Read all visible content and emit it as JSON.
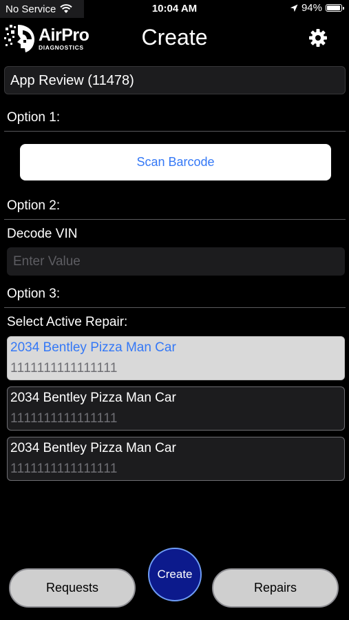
{
  "status_bar": {
    "carrier": "No Service",
    "time": "10:04 AM",
    "battery_percent": "94%",
    "battery_level": 0.94
  },
  "header": {
    "logo": {
      "name": "AirPro",
      "subtitle": "DIAGNOSTICS"
    },
    "title": "Create",
    "settings_icon": "gear-icon"
  },
  "shop_selector": {
    "value": "App Review (11478)"
  },
  "option1": {
    "label": "Option 1:",
    "scan_button_label": "Scan Barcode"
  },
  "option2": {
    "label": "Option 2:",
    "decode_label": "Decode VIN",
    "vin_placeholder": "Enter Value",
    "vin_value": ""
  },
  "option3": {
    "label": "Option 3:",
    "select_label": "Select Active Repair:",
    "repairs": [
      {
        "title": "2034 Bentley Pizza Man Car",
        "vin": "1111111111111111",
        "selected": true
      },
      {
        "title": "2034 Bentley Pizza Man Car",
        "vin": "1111111111111111",
        "selected": false
      },
      {
        "title": "2034 Bentley Pizza Man Car",
        "vin": "1111111111111111",
        "selected": false
      }
    ]
  },
  "bottom_nav": {
    "requests_label": "Requests",
    "create_label": "Create",
    "repairs_label": "Repairs"
  },
  "colors": {
    "background": "#000000",
    "accent_blue": "#3478f6",
    "fab_fill": "#0c1a8c",
    "field_fill": "#1c1c1e",
    "selected_fill": "#d9d9d9",
    "pill_fill": "#cfcfcf"
  }
}
